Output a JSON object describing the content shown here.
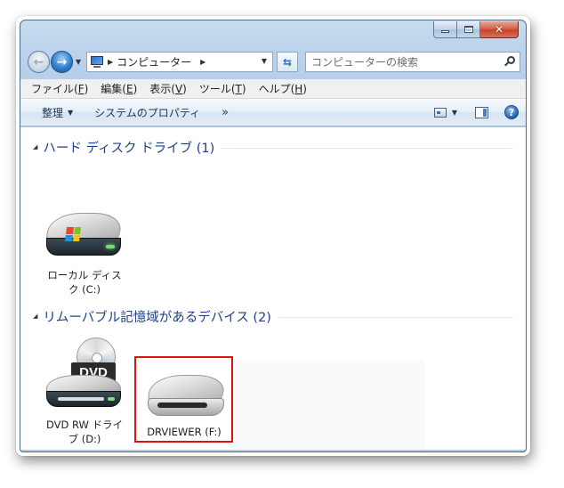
{
  "search": {
    "placeholder": "コンピューターの検索"
  },
  "address": {
    "crumb": "コンピューター"
  },
  "menu": [
    {
      "label": "ファイル(",
      "key": "F",
      "end": ")"
    },
    {
      "label": "編集(",
      "key": "E",
      "end": ")"
    },
    {
      "label": "表示(",
      "key": "V",
      "end": ")"
    },
    {
      "label": "ツール(",
      "key": "T",
      "end": ")"
    },
    {
      "label": "ヘルプ(",
      "key": "H",
      "end": ")"
    }
  ],
  "toolbar": {
    "organize": "整理",
    "system_properties": "システムのプロパティ",
    "more": "»"
  },
  "groups": {
    "hdd": {
      "title": "ハード ディスク ドライブ (1)"
    },
    "removable": {
      "title": "リムーバブル記憶域があるデバイス (2)"
    }
  },
  "drives": {
    "local": {
      "line1": "ローカル ディス",
      "line2": "ク (C:)"
    },
    "dvd": {
      "badge": "DVD",
      "line1": "DVD RW ドライ",
      "line2": "ブ (D:)"
    },
    "usb": {
      "line1": "DRVIEWER (F:)"
    }
  },
  "icons": {
    "back": "back-arrow-icon",
    "forward": "forward-arrow-icon",
    "refresh": "refresh-icon",
    "search": "search-icon",
    "help": "help-icon"
  },
  "colors": {
    "highlight": "#e01010",
    "group_title": "#1e3f8a"
  }
}
